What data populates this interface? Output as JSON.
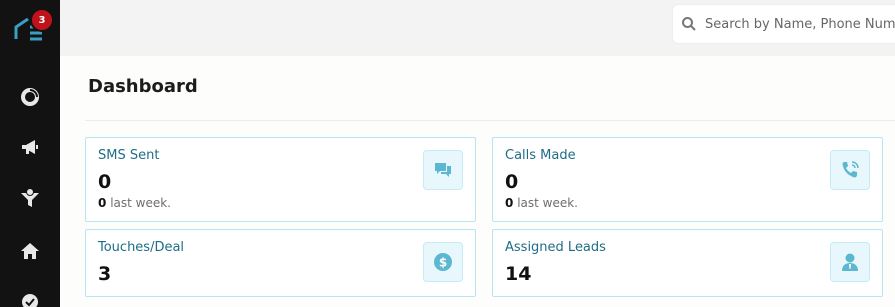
{
  "sidebar": {
    "logo_icon": "app-logo-icon",
    "notification_count": "3",
    "items": [
      {
        "icon": "donut-icon"
      },
      {
        "icon": "megaphone-icon"
      },
      {
        "icon": "funnel-dollar-icon"
      },
      {
        "icon": "home-icon"
      },
      {
        "icon": "check-circle-icon"
      }
    ]
  },
  "header": {
    "search_placeholder": "Search by Name, Phone Number"
  },
  "main": {
    "title": "Dashboard",
    "cards": [
      {
        "label": "SMS Sent",
        "value": "0",
        "sub_value": "0",
        "sub_text": "last week.",
        "icon": "chat-icon"
      },
      {
        "label": "Calls Made",
        "value": "0",
        "sub_value": "0",
        "sub_text": "last week.",
        "icon": "phone-icon"
      },
      {
        "label": "Touches/Deal",
        "value": "3",
        "icon": "dollar-icon"
      },
      {
        "label": "Assigned Leads",
        "value": "14",
        "icon": "user-icon"
      }
    ]
  },
  "colors": {
    "sidebar_bg": "#121212",
    "badge": "#c0121a",
    "accent": "#5bb8d0",
    "card_border": "#b8e4f3"
  }
}
